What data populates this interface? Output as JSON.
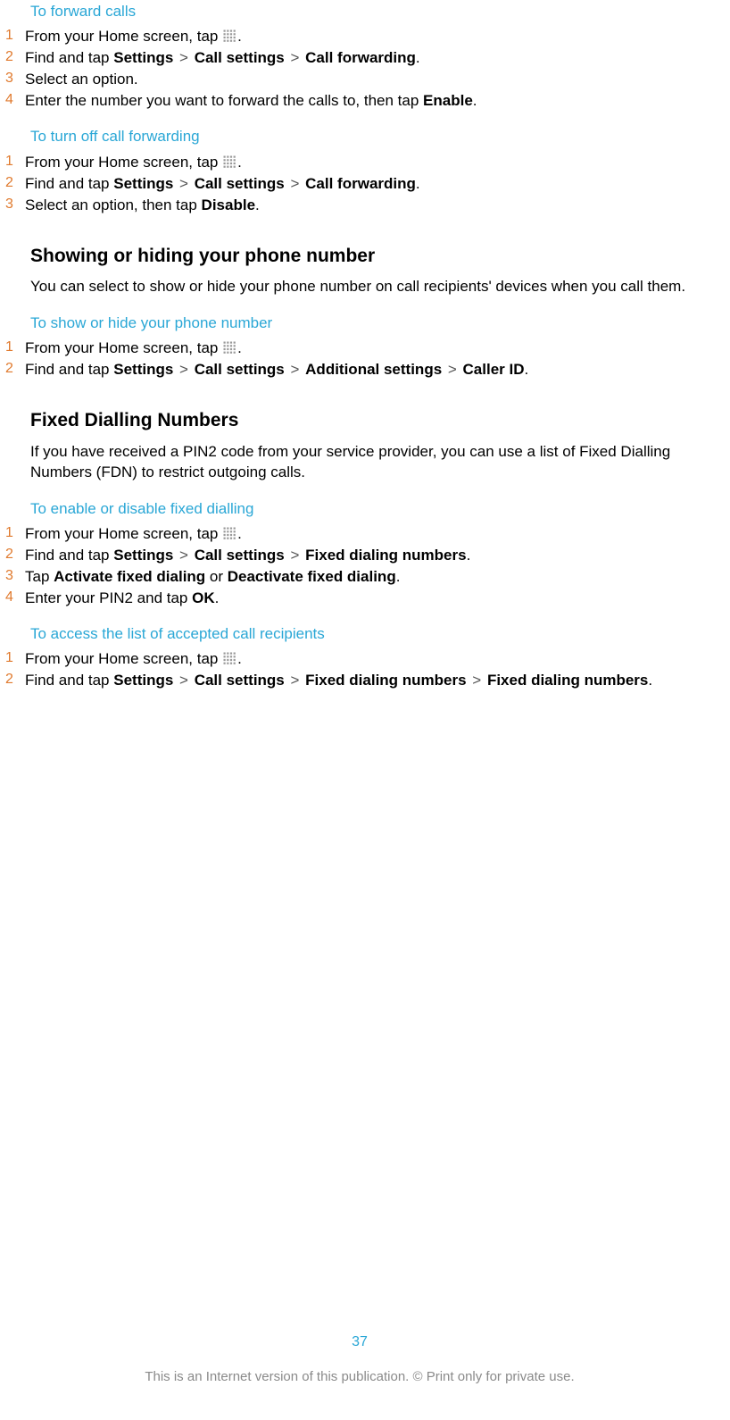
{
  "sec1": {
    "title": "To forward calls",
    "steps": [
      {
        "n": "1",
        "parts": [
          {
            "t": "From your Home screen, tap "
          },
          {
            "icon": "apps"
          },
          {
            "t": "."
          }
        ]
      },
      {
        "n": "2",
        "parts": [
          {
            "t": "Find and tap "
          },
          {
            "b": "Settings"
          },
          {
            "gt": ">"
          },
          {
            "b": "Call settings"
          },
          {
            "gt": ">"
          },
          {
            "b": "Call forwarding"
          },
          {
            "t": "."
          }
        ]
      },
      {
        "n": "3",
        "parts": [
          {
            "t": "Select an option."
          }
        ]
      },
      {
        "n": "4",
        "parts": [
          {
            "t": "Enter the number you want to forward the calls to, then tap "
          },
          {
            "b": "Enable"
          },
          {
            "t": "."
          }
        ]
      }
    ]
  },
  "sec2": {
    "title": "To turn off call forwarding",
    "steps": [
      {
        "n": "1",
        "parts": [
          {
            "t": "From your Home screen, tap "
          },
          {
            "icon": "apps"
          },
          {
            "t": "."
          }
        ]
      },
      {
        "n": "2",
        "parts": [
          {
            "t": "Find and tap "
          },
          {
            "b": "Settings"
          },
          {
            "gt": ">"
          },
          {
            "b": "Call settings"
          },
          {
            "gt": ">"
          },
          {
            "b": "Call forwarding"
          },
          {
            "t": "."
          }
        ]
      },
      {
        "n": "3",
        "parts": [
          {
            "t": "Select an option, then tap "
          },
          {
            "b": "Disable"
          },
          {
            "t": "."
          }
        ]
      }
    ]
  },
  "head1": "Showing or hiding your phone number",
  "body1": "You can select to show or hide your phone number on call recipients' devices when you call them.",
  "sec3": {
    "title": "To show or hide your phone number",
    "steps": [
      {
        "n": "1",
        "parts": [
          {
            "t": "From your Home screen, tap "
          },
          {
            "icon": "apps"
          },
          {
            "t": "."
          }
        ]
      },
      {
        "n": "2",
        "parts": [
          {
            "t": "Find and tap "
          },
          {
            "b": "Settings"
          },
          {
            "gt": ">"
          },
          {
            "b": "Call settings"
          },
          {
            "gt": ">"
          },
          {
            "b": "Additional settings"
          },
          {
            "gt": ">"
          },
          {
            "b": "Caller ID"
          },
          {
            "t": "."
          }
        ]
      }
    ]
  },
  "head2": "Fixed Dialling Numbers",
  "body2": "If you have received a PIN2 code from your service provider, you can use a list of Fixed Dialling Numbers (FDN) to restrict outgoing calls.",
  "sec4": {
    "title": "To enable or disable fixed dialling",
    "steps": [
      {
        "n": "1",
        "parts": [
          {
            "t": "From your Home screen, tap "
          },
          {
            "icon": "apps"
          },
          {
            "t": "."
          }
        ]
      },
      {
        "n": "2",
        "parts": [
          {
            "t": "Find and tap "
          },
          {
            "b": "Settings"
          },
          {
            "gt": ">"
          },
          {
            "b": "Call settings"
          },
          {
            "gt": ">"
          },
          {
            "b": "Fixed dialing numbers"
          },
          {
            "t": "."
          }
        ]
      },
      {
        "n": "3",
        "parts": [
          {
            "t": "Tap "
          },
          {
            "b": "Activate fixed dialing"
          },
          {
            "t": " or "
          },
          {
            "b": "Deactivate fixed dialing"
          },
          {
            "t": "."
          }
        ]
      },
      {
        "n": "4",
        "parts": [
          {
            "t": "Enter your PIN2 and tap "
          },
          {
            "b": "OK"
          },
          {
            "t": "."
          }
        ]
      }
    ]
  },
  "sec5": {
    "title": "To access the list of accepted call recipients",
    "steps": [
      {
        "n": "1",
        "parts": [
          {
            "t": "From your Home screen, tap "
          },
          {
            "icon": "apps"
          },
          {
            "t": "."
          }
        ]
      },
      {
        "n": "2",
        "parts": [
          {
            "t": "Find and tap "
          },
          {
            "b": "Settings"
          },
          {
            "gt": ">"
          },
          {
            "b": "Call settings"
          },
          {
            "gt": ">"
          },
          {
            "b": "Fixed dialing numbers"
          },
          {
            "gt": ">"
          },
          {
            "b": "Fixed dialing numbers"
          },
          {
            "t": "."
          }
        ]
      }
    ]
  },
  "page_number": "37",
  "footer": "This is an Internet version of this publication. © Print only for private use."
}
